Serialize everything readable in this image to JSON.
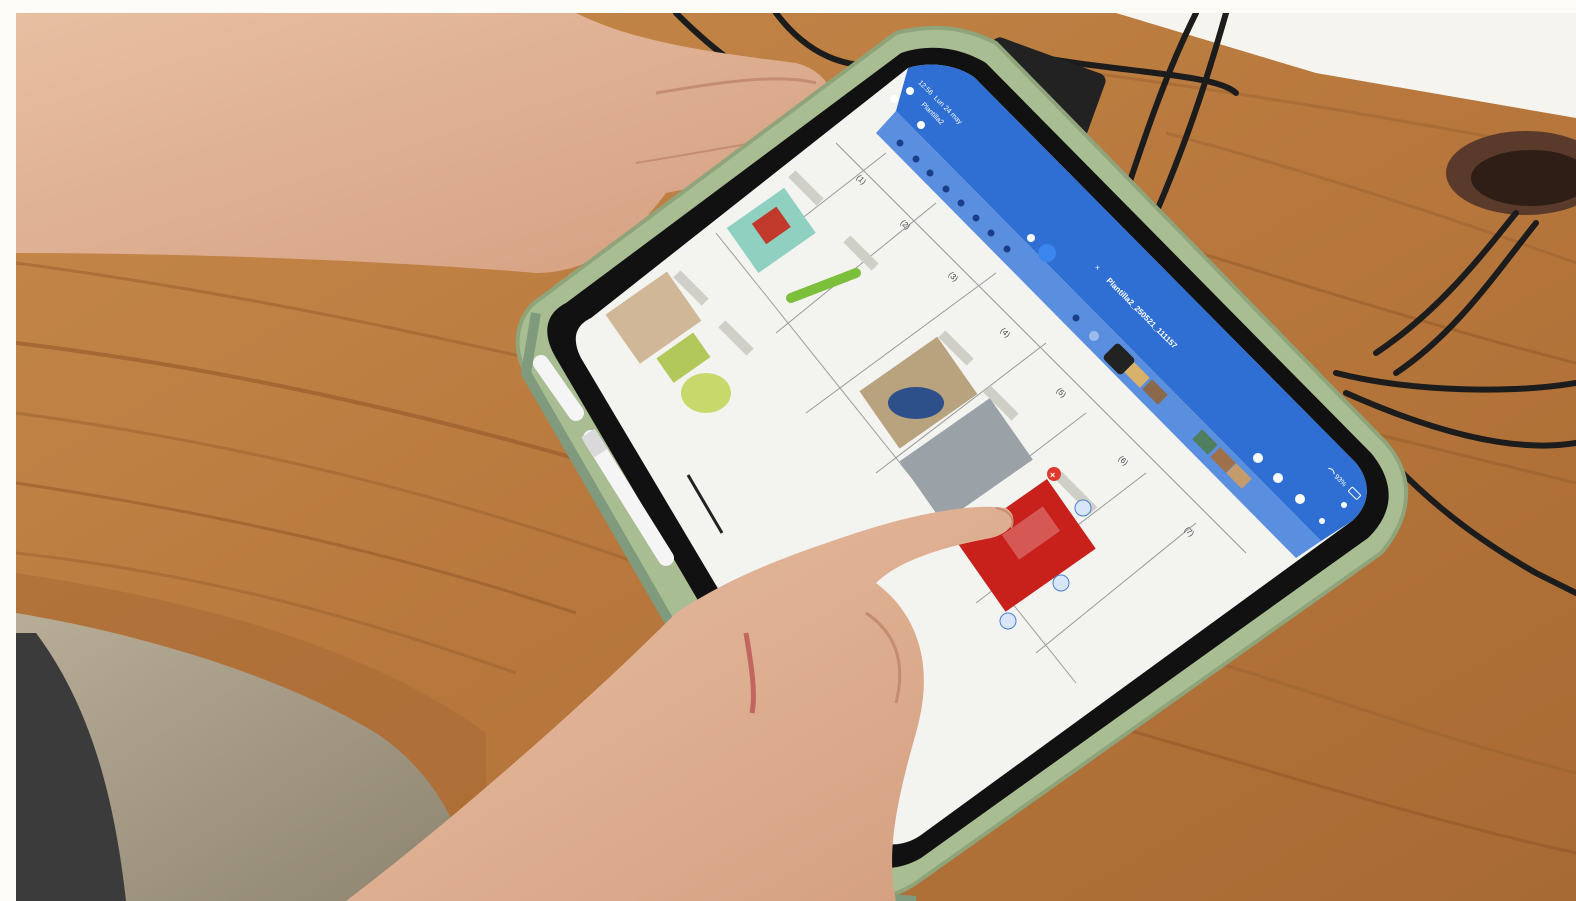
{
  "status_bar": {
    "time": "12:56",
    "date": "Lun 24 may",
    "battery": "93%"
  },
  "document": {
    "tab_title": "Plantilla2_250521_111157",
    "breadcrumb": "Plantilla2"
  },
  "table": {
    "row_numbers": [
      "(1)",
      "(2)",
      "(3)",
      "(4)",
      "(5)",
      "(6)",
      "(7)"
    ]
  },
  "colors": {
    "app_accent": "#2f6fd3",
    "toolbar_light": "#5a8fe0",
    "page_background": "#f3f3f0",
    "case": "#a9bd93",
    "wood": "#b8783d",
    "delete_badge": "#e03a2e"
  },
  "icons": [
    "undo-icon",
    "redo-icon",
    "search-icon",
    "pen-icon",
    "highlighter-icon",
    "eraser-icon",
    "lasso-icon",
    "shapes-icon",
    "image-icon",
    "text-icon",
    "camera-icon",
    "share-icon",
    "bookmark-icon",
    "add-page-icon",
    "more-icon",
    "close-icon",
    "wifi-icon",
    "battery-icon",
    "delete-badge-icon",
    "rotate-handle-icon"
  ]
}
